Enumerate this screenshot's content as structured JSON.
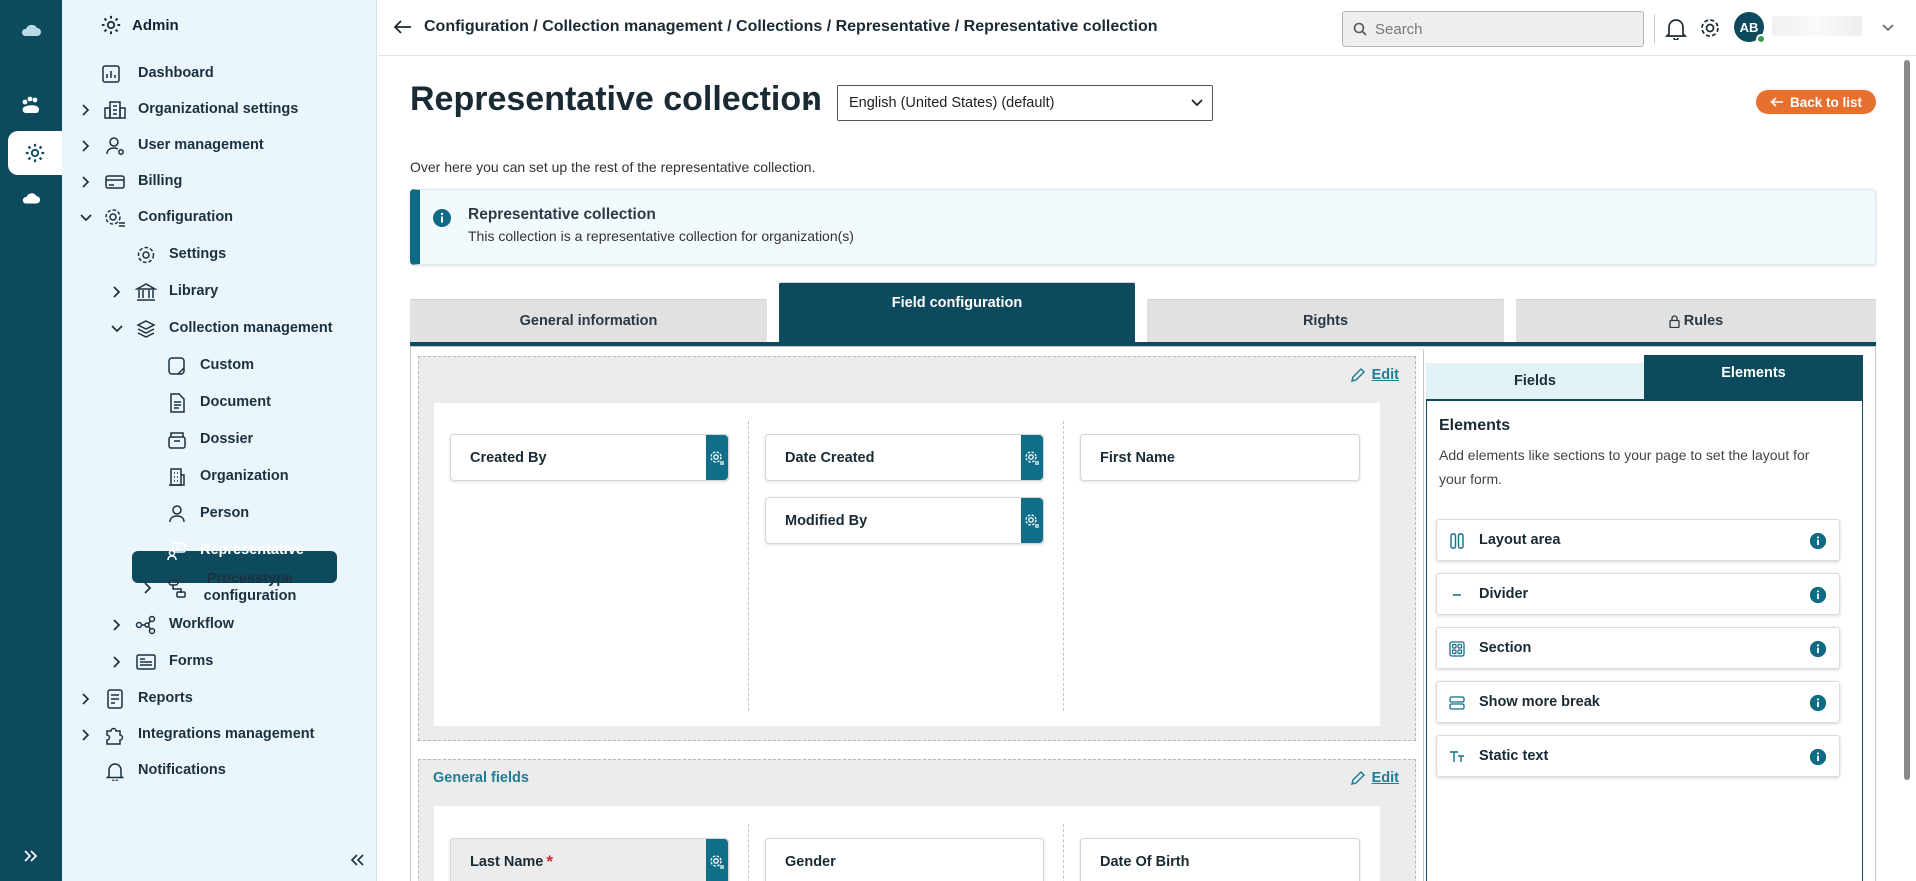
{
  "sidebar": {
    "title": "Admin",
    "items": [
      {
        "label": "Dashboard"
      },
      {
        "label": "Organizational settings"
      },
      {
        "label": "User management"
      },
      {
        "label": "Billing"
      },
      {
        "label": "Configuration"
      },
      {
        "label": "Settings"
      },
      {
        "label": "Library"
      },
      {
        "label": "Collection management"
      },
      {
        "label": "Custom"
      },
      {
        "label": "Document"
      },
      {
        "label": "Dossier"
      },
      {
        "label": "Organization"
      },
      {
        "label": "Person"
      },
      {
        "label": "Representative"
      },
      {
        "label": "Processtype configuration"
      },
      {
        "label": "Workflow"
      },
      {
        "label": "Forms"
      },
      {
        "label": "Reports"
      },
      {
        "label": "Integrations management"
      },
      {
        "label": "Notifications"
      }
    ]
  },
  "header": {
    "breadcrumb": "Configuration / Collection management / Collections / Representative / Representative collection",
    "search_placeholder": "Search",
    "avatar_initials": "AB"
  },
  "page": {
    "title": "Representative collection",
    "language": "English (United States) (default)",
    "back_label": "Back to list",
    "intro": "Over here you can set up the rest of the representative collection.",
    "info_title": "Representative collection",
    "info_text": "This collection is a representative collection for organization(s)"
  },
  "tabs": [
    {
      "label": "General information"
    },
    {
      "label": "Field configuration"
    },
    {
      "label": "Rights"
    },
    {
      "label": "Rules"
    }
  ],
  "sections": [
    {
      "title": "",
      "edit_label": "Edit",
      "fields": [
        "Created By",
        "Date Created",
        "First Name",
        "Modified By"
      ]
    },
    {
      "title": "General fields",
      "edit_label": "Edit",
      "fields": [
        "Last Name",
        "Gender",
        "Date Of Birth"
      ]
    }
  ],
  "panel": {
    "tabs": [
      "Fields",
      "Elements"
    ],
    "heading": "Elements",
    "description": "Add elements like sections to your page to set the layout for your form.",
    "elements": [
      "Layout area",
      "Divider",
      "Section",
      "Show more break",
      "Static text"
    ]
  },
  "colors": {
    "primary": "#0e4a5e",
    "accent": "#e8702f",
    "sidebar_bg": "#eaf6fb",
    "link": "#1f7d95"
  }
}
